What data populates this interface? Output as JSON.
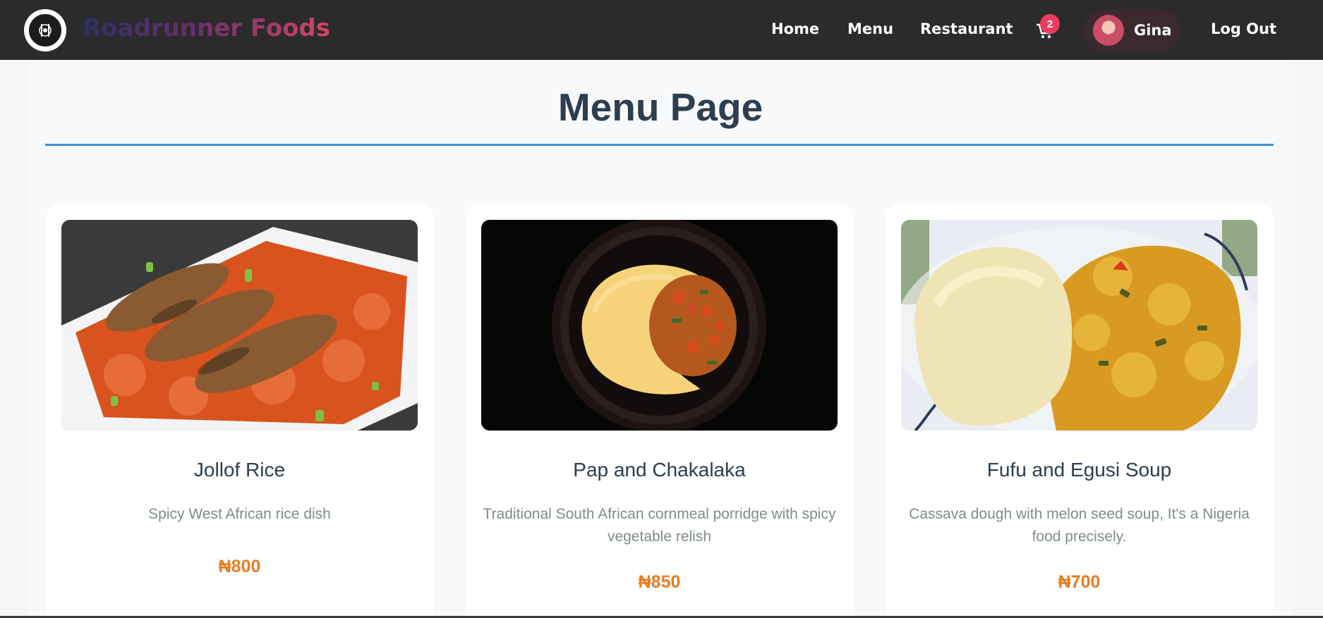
{
  "navbar": {
    "brand": "Roadrunner Foods",
    "logo_icon": "roadrunner-logo-icon",
    "links": {
      "home": "Home",
      "menu": "Menu",
      "restaurant": "Restaurant",
      "logout": "Log Out"
    },
    "cart_count": "2",
    "cart_icon": "shopping-cart-icon",
    "user_name": "Gina"
  },
  "page": {
    "title": "Menu Page"
  },
  "menu_items": [
    {
      "name": "Jollof Rice",
      "description": "Spicy West African rice dish",
      "price": "₦800",
      "image_icon": "jollof-rice-photo"
    },
    {
      "name": "Pap and Chakalaka",
      "description": "Traditional South African cornmeal porridge with spicy vegetable relish",
      "price": "₦850",
      "image_icon": "pap-chakalaka-photo"
    },
    {
      "name": "Fufu and Egusi Soup",
      "description": "Cassava dough with melon seed soup, It's a Nigeria food precisely.",
      "price": "₦700",
      "image_icon": "fufu-egusi-photo"
    }
  ],
  "colors": {
    "navbar_bg": "#2b2b2b",
    "accent_pink": "#d24566",
    "title_color": "#2c3e50",
    "rule_blue": "#3a8fd0",
    "price_orange": "#e67e22",
    "badge_red": "#ef3b5f"
  }
}
